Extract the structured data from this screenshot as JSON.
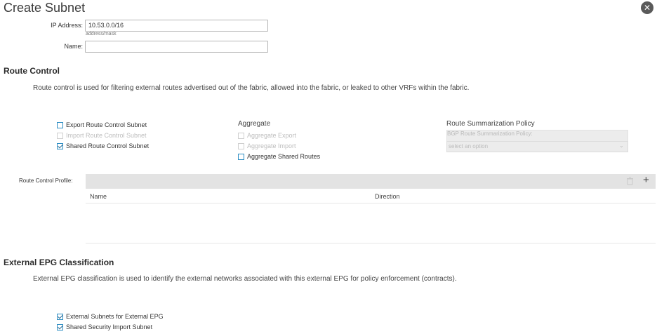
{
  "dialog": {
    "title": "Create Subnet",
    "close_icon": "close-icon"
  },
  "form": {
    "ip_label": "IP Address:",
    "ip_value": "10.53.0.0/16",
    "ip_hint": "address/mask",
    "name_label": "Name:",
    "name_value": ""
  },
  "route_control": {
    "title": "Route Control",
    "description": "Route control is used for filtering external routes advertised out of the fabric, allowed into the fabric, or leaked to other VRFs within the fabric.",
    "checkboxes": [
      {
        "label": "Export Route Control Subnet",
        "checked": false,
        "disabled": false
      },
      {
        "label": "Import Route Control Subnet",
        "checked": false,
        "disabled": true
      },
      {
        "label": "Shared Route Control Subnet",
        "checked": true,
        "disabled": false
      }
    ],
    "aggregate": {
      "title": "Aggregate",
      "checkboxes": [
        {
          "label": "Aggregate Export",
          "checked": false,
          "disabled": true
        },
        {
          "label": "Aggregate Import",
          "checked": false,
          "disabled": true
        },
        {
          "label": "Aggregate Shared Routes",
          "checked": false,
          "disabled": false
        }
      ]
    },
    "summarization": {
      "title": "Route Summarization Policy",
      "bgp_label": "BGP Route Summarization Policy:",
      "select_placeholder": "select an option"
    },
    "profile": {
      "label": "Route Control Profile:",
      "columns": [
        "Name",
        "Direction"
      ],
      "trash_icon": "trash-icon",
      "add_icon": "plus-icon"
    }
  },
  "external_epg": {
    "title": "External EPG Classification",
    "description": "External EPG classification is used to identify the external networks associated with this external EPG for policy enforcement (contracts).",
    "checkboxes": [
      {
        "label": "External Subnets for External EPG",
        "checked": true
      },
      {
        "label": "Shared Security Import Subnet",
        "checked": true
      }
    ]
  },
  "colors": {
    "checkbox_border": "#2d8ec4",
    "disabled_text": "#bdbdbd",
    "toolbar_bg": "#e3e3e3"
  }
}
